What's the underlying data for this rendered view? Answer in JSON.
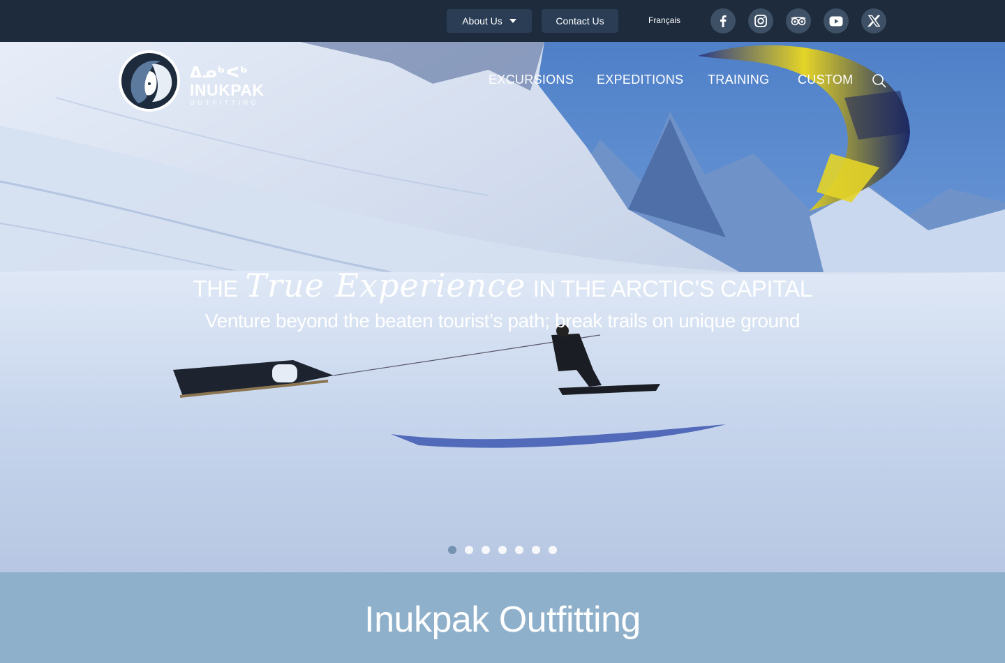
{
  "topbar": {
    "about_label": "About Us",
    "contact_label": "Contact Us",
    "language_label": "Français",
    "social": [
      {
        "name": "facebook-icon"
      },
      {
        "name": "instagram-icon"
      },
      {
        "name": "tripadvisor-icon"
      },
      {
        "name": "youtube-icon"
      },
      {
        "name": "x-twitter-icon"
      }
    ]
  },
  "logo": {
    "syllabics": "ᐃᓄᒃᐸᒃ",
    "name": "INUKPAK",
    "sub": "OUTFITTING"
  },
  "nav": {
    "items": [
      {
        "label": "EXCURSIONS"
      },
      {
        "label": "EXPEDITIONS"
      },
      {
        "label": "TRAINING"
      },
      {
        "label": "CUSTOM"
      }
    ]
  },
  "hero": {
    "headline_start": "THE",
    "headline_script": "True Experience",
    "headline_end": "IN THE ARCTIC’S CAPITAL",
    "tagline": "Venture beyond the beaten tourist’s path; break trails on unique ground",
    "slides_total": 7,
    "active_slide": 1
  },
  "intro": {
    "title": "Inukpak Outfitting"
  },
  "colors": {
    "topbar_bg": "#1d2b3d",
    "pill_bg": "#2a3d55",
    "social_bg": "#3e5065",
    "section_bg": "#8fb0cb"
  }
}
